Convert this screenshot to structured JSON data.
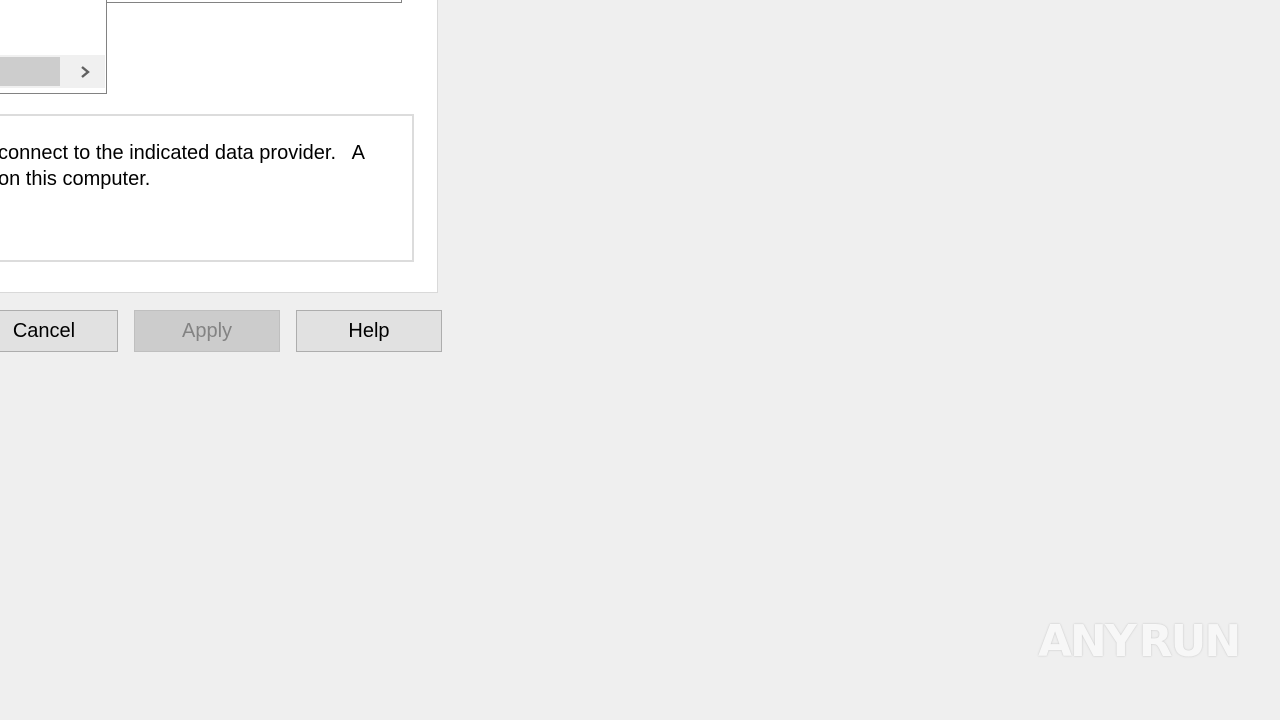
{
  "description": {
    "line1": "connect to the indicated data provider.   A",
    "line2": "on this computer."
  },
  "buttons": {
    "cancel": "Cancel",
    "apply": "Apply",
    "help": "Help"
  },
  "watermark": {
    "left": "ANY",
    "right": "RUN"
  },
  "colors": {
    "background": "#efefef",
    "panel": "#ffffff",
    "button": "#e1e1e1",
    "button_disabled": "#cccccc",
    "disabled_text": "#838383"
  },
  "icons": {
    "scroll_right": "chevron-right-icon",
    "watermark_logo": "play-triangle-icon"
  }
}
